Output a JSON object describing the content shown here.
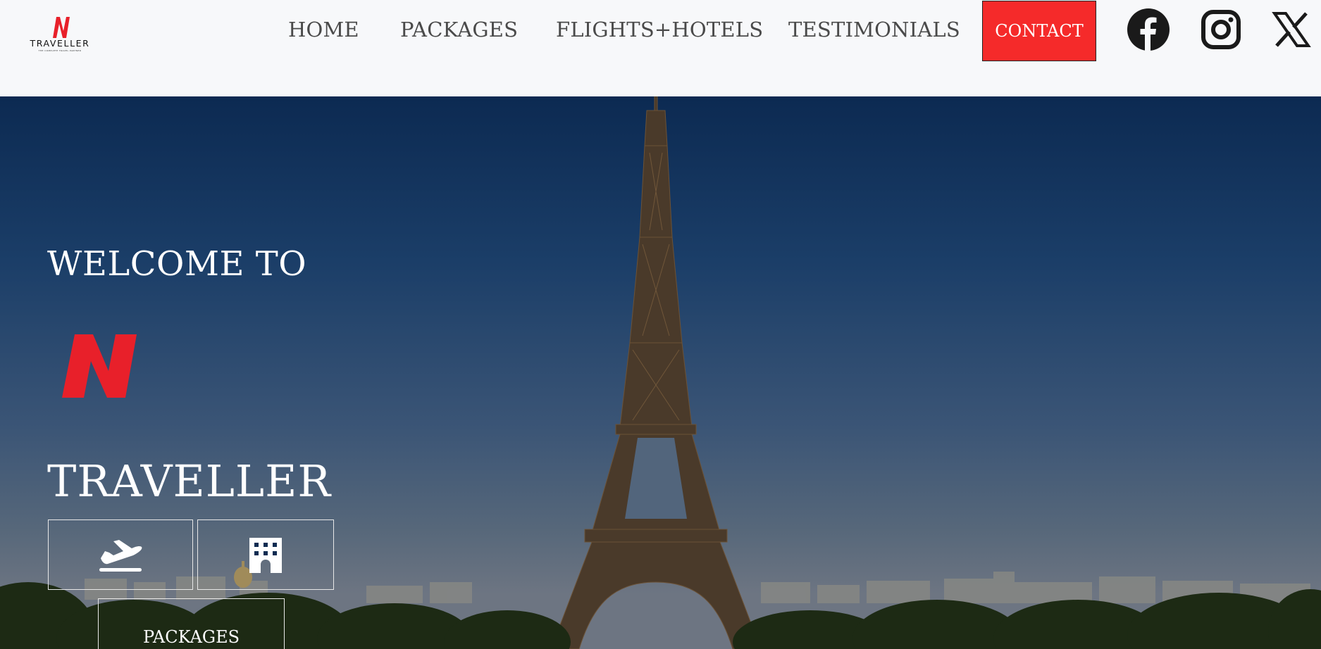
{
  "header": {
    "logo": {
      "mark": "N",
      "brand": "TRAVELLER",
      "tagline": "THE COMPLETE TRAVEL PARTNER"
    },
    "nav": {
      "home": "HOME",
      "packages": "PACKAGES",
      "flights_hotels": "FLIGHTS+HOTELS",
      "testimonials": "TESTIMONIALS",
      "contact": "CONTACT"
    },
    "social": [
      "facebook-icon",
      "instagram-icon",
      "x-icon"
    ]
  },
  "hero": {
    "welcome": "WELCOME TO",
    "logo_mark": "N",
    "title": "TRAVELLER",
    "buttons": {
      "flight_icon": "airplane-departure-icon",
      "hotel_icon": "hotel-building-icon",
      "packages": "PACKAGES"
    },
    "background": "eiffel-tower-paris-photo"
  },
  "colors": {
    "accent": "#f52a2a",
    "logo_red": "#e8202a",
    "header_bg": "#f7f8fa",
    "nav_text": "#4a4a4a"
  }
}
